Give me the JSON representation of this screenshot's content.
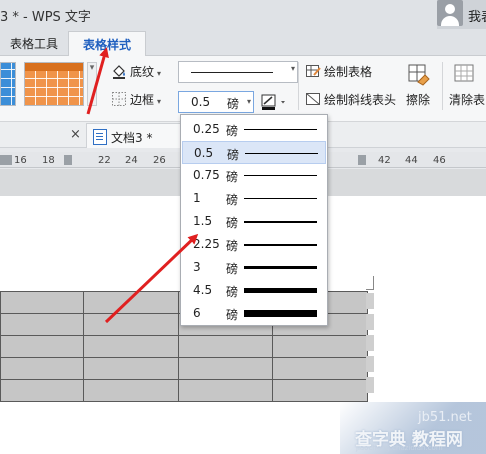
{
  "window": {
    "title": "3 * - WPS 文字",
    "user_label": "我表"
  },
  "tabs": [
    {
      "label": "表格工具",
      "active": false
    },
    {
      "label": "表格样式",
      "active": true
    }
  ],
  "ribbon": {
    "shading_label": "底纹",
    "border_label": "边框",
    "line_weight": {
      "value": "0.5",
      "unit": "磅"
    },
    "draw_table_label": "绘制表格",
    "draw_diagonal_label": "绘制斜线表头",
    "erase_label": "擦除",
    "clear_label": "清除表",
    "colors": {
      "accent_blue": "#3c8ed8",
      "accent_orange": "#f0944a"
    }
  },
  "document_tab": {
    "label": "文档3 *",
    "close_glyph": "×"
  },
  "ruler": {
    "ticks": [
      "16",
      "18",
      "22",
      "24",
      "26",
      "42",
      "44",
      "46"
    ]
  },
  "line_weight_menu": {
    "items": [
      {
        "value": "0.25",
        "unit": "磅",
        "weight": 0.25,
        "selected": false
      },
      {
        "value": "0.5",
        "unit": "磅",
        "weight": 0.5,
        "selected": true
      },
      {
        "value": "0.75",
        "unit": "磅",
        "weight": 0.75,
        "selected": false
      },
      {
        "value": "1",
        "unit": "磅",
        "weight": 1,
        "selected": false
      },
      {
        "value": "1.5",
        "unit": "磅",
        "weight": 1.5,
        "selected": false
      },
      {
        "value": "2.25",
        "unit": "磅",
        "weight": 2.25,
        "selected": false
      },
      {
        "value": "3",
        "unit": "磅",
        "weight": 3,
        "selected": false
      },
      {
        "value": "4.5",
        "unit": "磅",
        "weight": 4.5,
        "selected": false
      },
      {
        "value": "6",
        "unit": "磅",
        "weight": 6,
        "selected": false
      }
    ]
  },
  "table": {
    "rows": 5,
    "cols": 4,
    "cell_color": "#c6c6c6"
  },
  "annotation": {
    "arrow_color": "#e02020"
  },
  "watermark": {
    "site": "jb51.net",
    "text": "查字典 教程网",
    "url": "jiaocheng.chazidian.com"
  }
}
